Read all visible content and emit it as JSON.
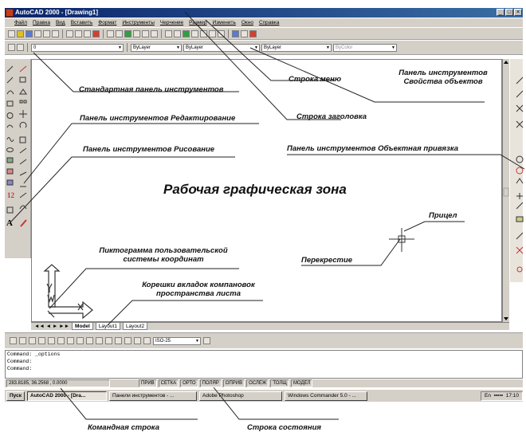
{
  "window": {
    "title": "AutoCAD 2000 - [Drawing1]",
    "controls": [
      "_",
      "□",
      "×"
    ]
  },
  "menu": [
    "Файл",
    "Правка",
    "Вид",
    "Вставить",
    "Формат",
    "Инструменты",
    "Черчение",
    "Размер",
    "Изменить",
    "Окно",
    "Справка"
  ],
  "properties_toolbar": {
    "layer": "0",
    "color": "ByLayer",
    "linetype": "ByLayer",
    "lineweight": "ByLayer",
    "plotstyle": "ByColor"
  },
  "layout_tabs": [
    "Model",
    "Layout1",
    "Layout2"
  ],
  "dim_style": "ISO-25",
  "command_lines": [
    "Command: _options",
    "Command:",
    "Command:"
  ],
  "status": {
    "coords": "283.8185, 36.2568 , 0.0000",
    "buttons": [
      "ПРИВ",
      "СЕТКА",
      "ОРТО",
      "ПОЛЯР",
      "ОПРИВ",
      "ОСЛЕЖ",
      "ТОЛЩ",
      "МОДЕЛ"
    ]
  },
  "taskbar": {
    "start": "Пуск",
    "items": [
      "AutoCAD 2000 - [Dra...",
      "Панели инструментов - ...",
      "Adobe Photoshop",
      "Windows Commander 5.0 - ..."
    ],
    "lang": "En",
    "clock": "17:10"
  },
  "annotations": {
    "standard_toolbar": "Стандартная панель инструментов",
    "menu_bar": "Строка меню",
    "properties_toolbar": "Панель инструментов Свойства объектов",
    "title_bar": "Строка заголовка",
    "modify_toolbar": "Панель инструментов Редактирование",
    "draw_toolbar": "Панель инструментов Рисование",
    "osnap_toolbar": "Панель инструментов Объектная привязка",
    "drawing_area": "Рабочая графическая зона",
    "aperture": "Прицел",
    "crosshair": "Перекрестие",
    "ucs_icon": "Пиктограмма пользовательской системы координат",
    "layout_tabs": "Корешки вкладок компановок пространства листа",
    "command_line": "Командная строка",
    "status_line": "Строка состояния"
  }
}
